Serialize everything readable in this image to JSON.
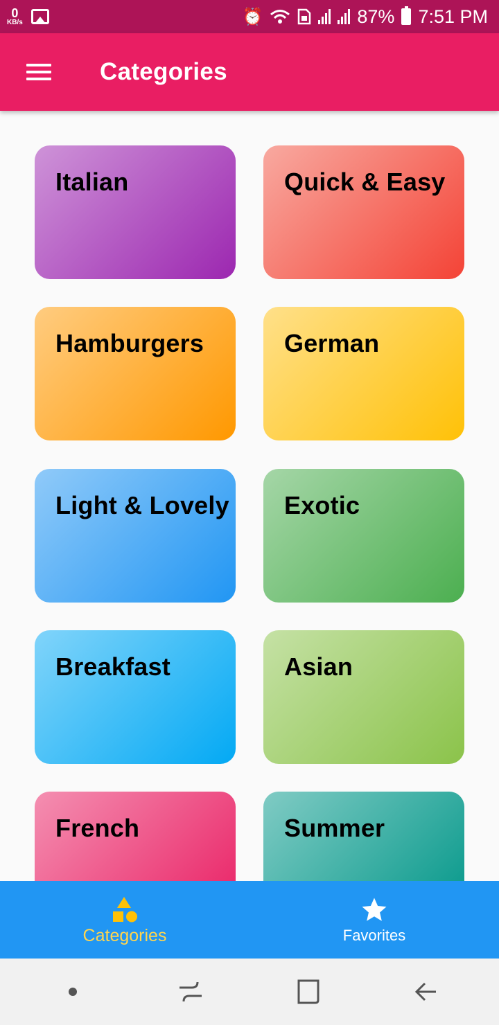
{
  "status_bar": {
    "speed_value": "0",
    "speed_unit": "KB/s",
    "battery": "87%",
    "time": "7:51 PM"
  },
  "app_bar": {
    "title": "Categories"
  },
  "categories": [
    {
      "label": "Italian",
      "color_from": "#ce93d8",
      "color_to": "#9c27b0"
    },
    {
      "label": "Quick & Easy",
      "color_from": "#f8a9a0",
      "color_to": "#f44336"
    },
    {
      "label": "Hamburgers",
      "color_from": "#ffcc80",
      "color_to": "#ff9800"
    },
    {
      "label": "German",
      "color_from": "#ffe08a",
      "color_to": "#ffc107"
    },
    {
      "label": "Light & Lovely",
      "color_from": "#90caf9",
      "color_to": "#2196f3"
    },
    {
      "label": "Exotic",
      "color_from": "#a5d6a7",
      "color_to": "#4caf50"
    },
    {
      "label": "Breakfast",
      "color_from": "#81d4fa",
      "color_to": "#03a9f4"
    },
    {
      "label": "Asian",
      "color_from": "#c5e1a5",
      "color_to": "#8bc34a"
    },
    {
      "label": "French",
      "color_from": "#f48fb1",
      "color_to": "#e91e63"
    },
    {
      "label": "Summer",
      "color_from": "#80cbc4",
      "color_to": "#009688"
    }
  ],
  "bottom_nav": {
    "items": [
      {
        "label": "Categories",
        "icon": "category-shapes-icon",
        "active": true
      },
      {
        "label": "Favorites",
        "icon": "star-icon",
        "active": false
      }
    ],
    "active_color": "#ffd54f",
    "background": "#2196f3"
  },
  "colors": {
    "status_bar": "#ad1457",
    "app_bar": "#e91e63"
  }
}
